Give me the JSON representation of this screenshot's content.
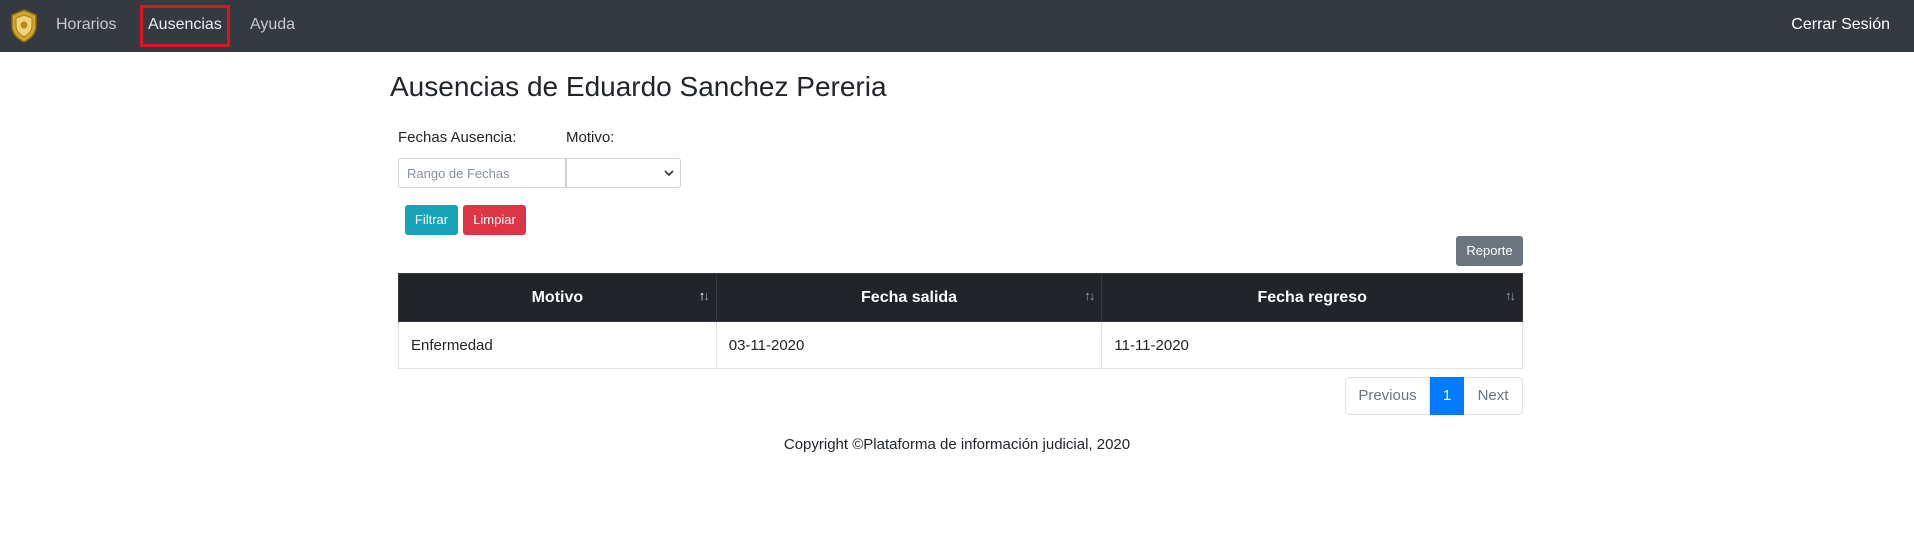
{
  "navbar": {
    "logo_icon": "shield-badge-icon",
    "items": [
      {
        "label": "Horarios"
      },
      {
        "label": "Ausencias"
      },
      {
        "label": "Ayuda"
      }
    ],
    "logout_label": "Cerrar Sesión",
    "highlight_color": "#e0121b"
  },
  "page": {
    "title": "Ausencias de Eduardo Sanchez Pereria"
  },
  "filters": {
    "dates_label": "Fechas Ausencia:",
    "reason_label": "Motivo:",
    "dates_placeholder": "Rango de Fechas",
    "reason_value": "",
    "filter_button": "Filtrar",
    "clear_button": "Limpiar"
  },
  "report_button": "Reporte",
  "table": {
    "columns": [
      "Motivo",
      "Fecha salida",
      "Fecha regreso"
    ],
    "rows": [
      [
        "Enfermedad",
        "03-11-2020",
        "11-11-2020"
      ]
    ]
  },
  "pagination": {
    "previous": "Previous",
    "current": "1",
    "next": "Next"
  },
  "footer": {
    "text": "Copyright ©Plataforma de información judicial, 2020"
  },
  "colors": {
    "navbar": "#343a40",
    "filter": "#17a2b8",
    "clear": "#dc3545",
    "report": "#6c757d",
    "table_header": "#212529",
    "page_active": "#007bff"
  }
}
